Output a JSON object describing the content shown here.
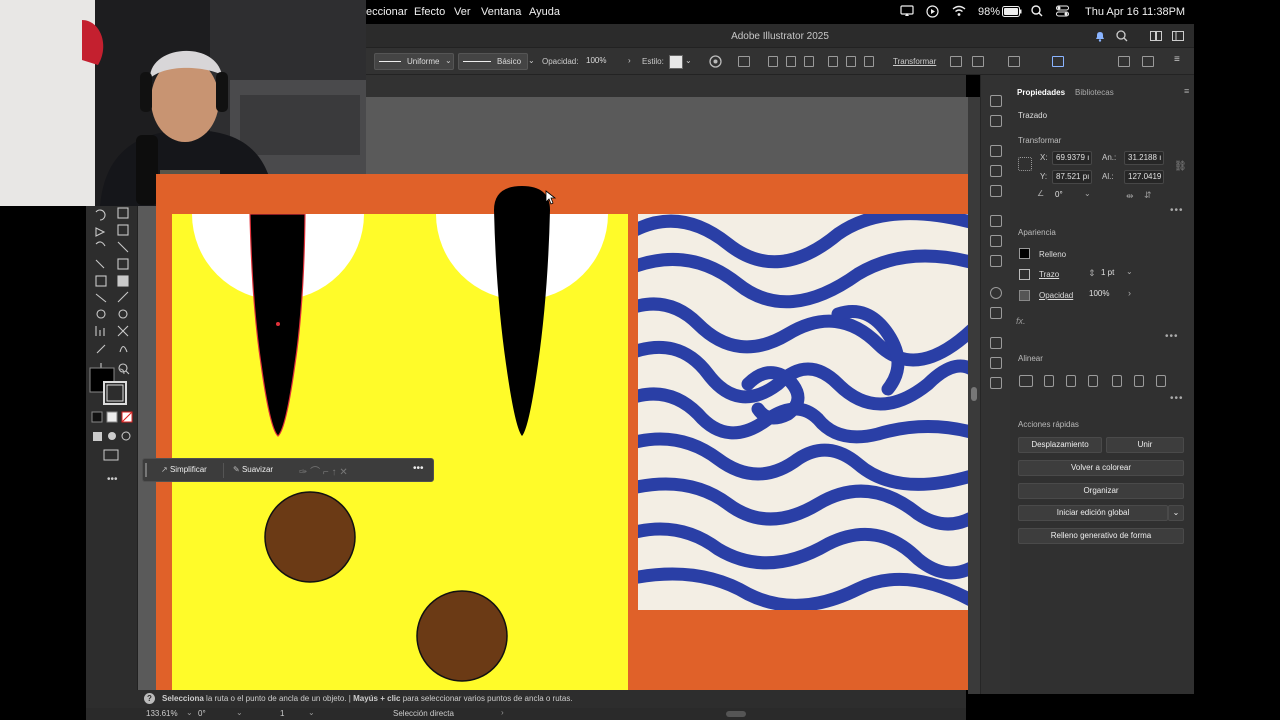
{
  "menubar": {
    "items": [
      "eccionar",
      "Efecto",
      "Ver",
      "Ventana",
      "Ayuda"
    ],
    "battery": "98%",
    "datetime": "Thu Apr 16  11:38PM"
  },
  "window": {
    "title": "Adobe Illustrator 2025"
  },
  "control_bar": {
    "stroke_profile": "Uniforme",
    "brush": "Básico",
    "opacity_label": "Opacidad:",
    "opacity_value": "100%",
    "style_label": "Estilo:",
    "transform_label": "Transformar"
  },
  "float_toolbar": {
    "simplify": "Simplificar",
    "smooth": "Suavizar"
  },
  "properties_panel": {
    "tabs": [
      "Propiedades",
      "Bibliotecas"
    ],
    "selection_type": "Trazado",
    "transform": {
      "title": "Transformar",
      "x_label": "X:",
      "x_value": "69.9379 ı",
      "y_label": "Y:",
      "y_value": "87.521 pı",
      "w_label": "An.:",
      "w_value": "31.2188 ı",
      "h_label": "Al.:",
      "h_value": "127.0419",
      "angle_value": "0°"
    },
    "appearance": {
      "title": "Apariencia",
      "fill_label": "Relleno",
      "stroke_label": "Trazo",
      "stroke_weight": "1 pt",
      "opacity_label": "Opacidad",
      "opacity_value": "100%"
    },
    "fx_label": "fx.",
    "align_title": "Alinear",
    "quick_actions": {
      "title": "Acciones rápidas",
      "offset": "Desplazamiento",
      "unite": "Unir",
      "recolor": "Volver a colorear",
      "organize": "Organizar",
      "global_edit": "Iniciar edición global",
      "generative_fill": "Relleno generativo de forma"
    }
  },
  "status": {
    "hint_bold1": "Selecciona",
    "hint1": " la ruta o el punto de ancla de un objeto.  |  ",
    "hint_bold2": "Mayús + clic",
    "hint2": " para seleccionar varios puntos de ancla o rutas."
  },
  "bottom_bar": {
    "zoom": "133.61%",
    "rotation": "0°",
    "artboard_index": "1",
    "tool": "Selección directa"
  },
  "colors": {
    "artboard_orange": "#e06129",
    "yellow": "#fffb29",
    "brown_circle": "#6b3a15",
    "zebra_blue": "#2a3fa6",
    "zebra_cream": "#f3eee4"
  }
}
